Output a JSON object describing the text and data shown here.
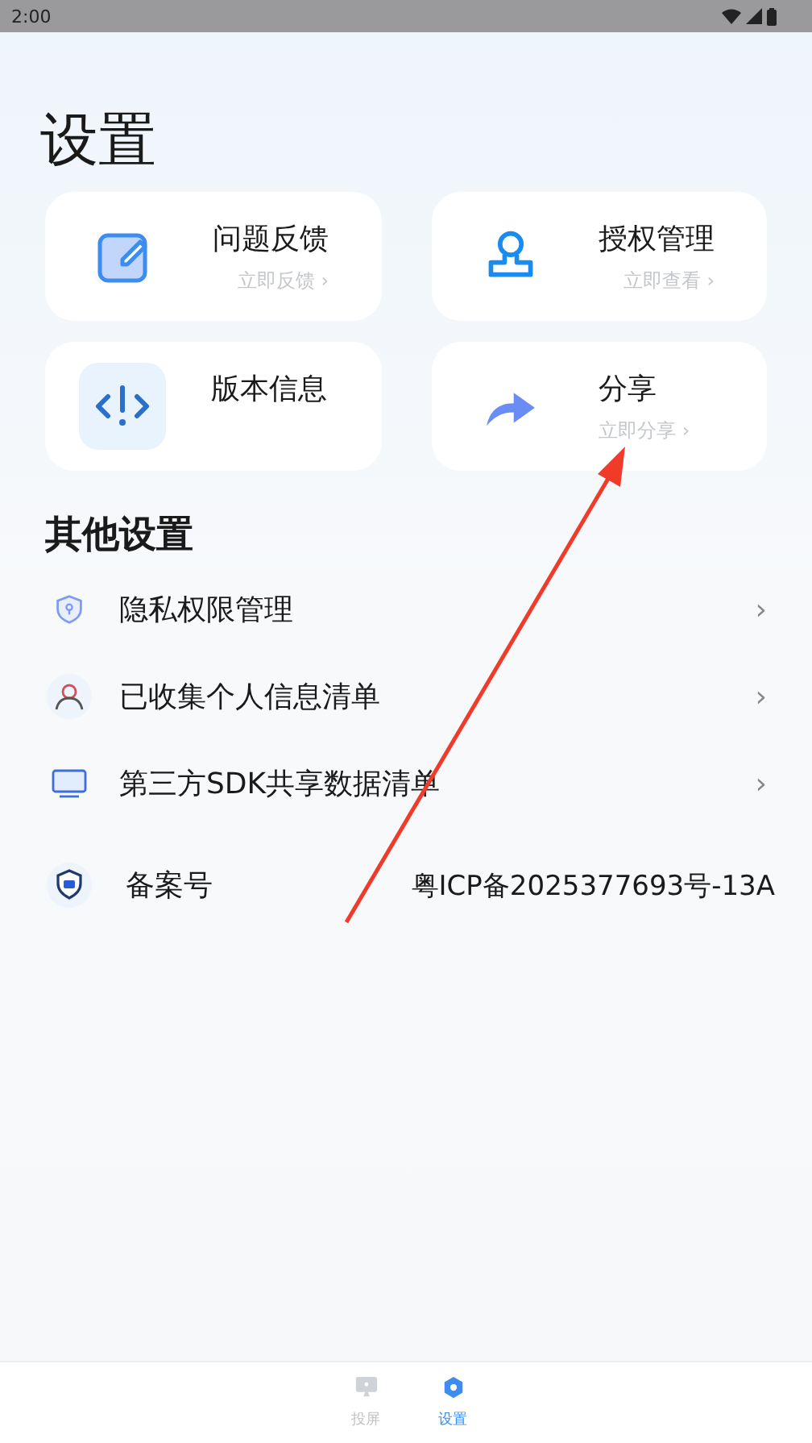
{
  "status_bar": {
    "time": "2:00"
  },
  "title": "设置",
  "cards": [
    {
      "kind": "feedback",
      "title": "问题反馈",
      "action": "立即反馈 ›"
    },
    {
      "kind": "auth",
      "title": "授权管理",
      "action": "立即查看 ›"
    },
    {
      "kind": "version",
      "title": "版本信息"
    },
    {
      "kind": "share",
      "title": "分享",
      "action": "立即分享 ›"
    }
  ],
  "section_title": "其他设置",
  "list": [
    {
      "kind": "privacy",
      "label": "隐私权限管理",
      "chevron": "›"
    },
    {
      "kind": "person",
      "label": "已收集个人信息清单",
      "chevron": "›"
    },
    {
      "kind": "sdk",
      "label": "第三方SDK共享数据清单",
      "chevron": "›"
    },
    {
      "kind": "record",
      "label": "备案号",
      "value": "粤ICP备2025377693号-13A"
    }
  ],
  "tabs": [
    {
      "kind": "cast",
      "label": "投屏",
      "selected": false
    },
    {
      "kind": "settings",
      "label": "设置",
      "selected": true
    }
  ]
}
